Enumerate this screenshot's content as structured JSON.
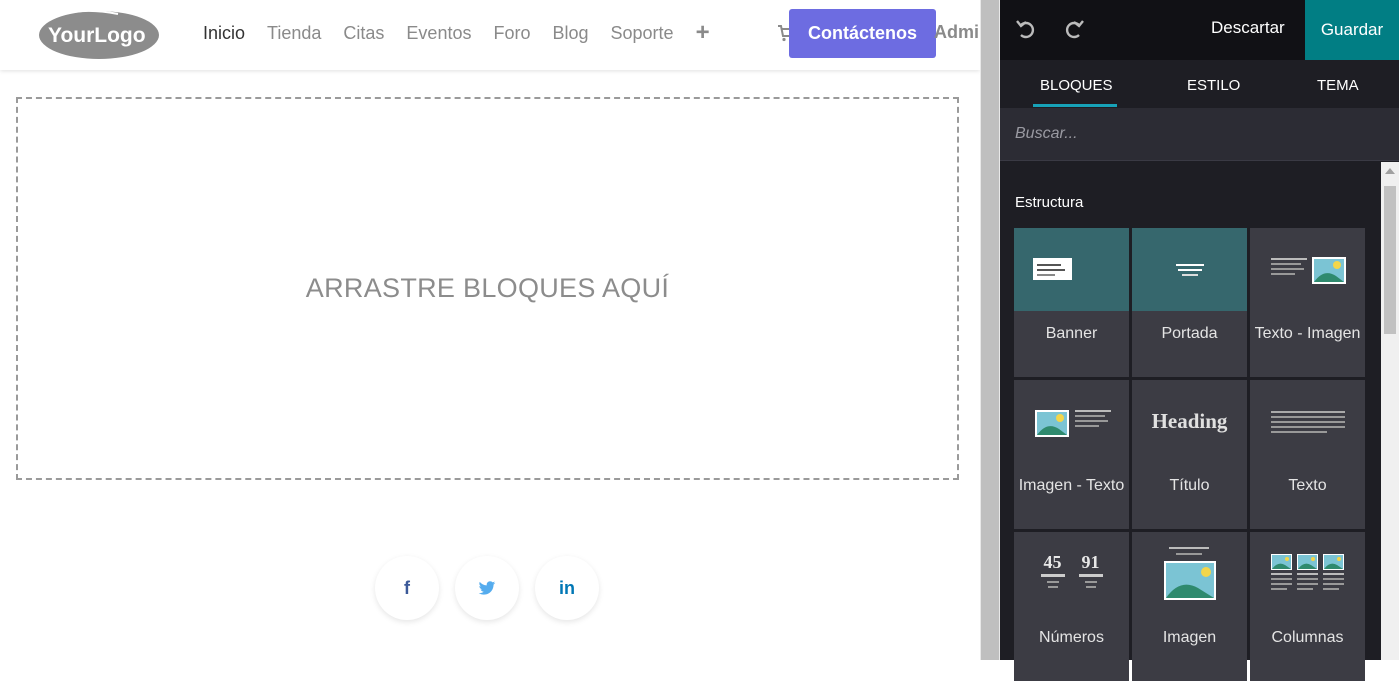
{
  "site": {
    "logo_text": "YourLogo",
    "nav": [
      "Inicio",
      "Tienda",
      "Citas",
      "Eventos",
      "Foro",
      "Blog",
      "Soporte"
    ],
    "add_menu_symbol": "+",
    "contact_label": "Contáctenos",
    "admin_label": "Admi",
    "dropzone_text": "ARRASTRE BLOQUES AQUÍ",
    "social": [
      {
        "name": "facebook-icon",
        "glyph": "f",
        "color": "#3b5998"
      },
      {
        "name": "twitter-icon",
        "glyph": "t",
        "color": "#55acee"
      },
      {
        "name": "linkedin-icon",
        "glyph": "in",
        "color": "#0077b5"
      }
    ],
    "colors": {
      "accent": "#6d6ce1",
      "text": "#8a8a8a"
    }
  },
  "editor": {
    "discard_label": "Descartar",
    "save_label": "Guardar",
    "tabs": [
      "BLOQUES",
      "ESTILO",
      "TEMA"
    ],
    "search_placeholder": "Buscar...",
    "section_title": "Estructura",
    "blocks": [
      {
        "label": "Banner",
        "icon": "banner-icon"
      },
      {
        "label": "Portada",
        "icon": "cover-icon"
      },
      {
        "label": "Texto - Imagen",
        "icon": "text-image-icon"
      },
      {
        "label": "Imagen - Texto",
        "icon": "image-text-icon"
      },
      {
        "label": "Título",
        "icon": "title-icon",
        "preview_text": "Heading"
      },
      {
        "label": "Texto",
        "icon": "text-icon"
      },
      {
        "label": "Números",
        "icon": "numbers-icon",
        "preview_numbers": [
          "45",
          "91"
        ]
      },
      {
        "label": "Imagen",
        "icon": "image-icon"
      },
      {
        "label": "Columnas",
        "icon": "columns-icon"
      }
    ],
    "colors": {
      "save": "#017e84",
      "tab_underline": "#17a2b8",
      "panel": "#1e1e24",
      "topbar": "#111115"
    }
  }
}
